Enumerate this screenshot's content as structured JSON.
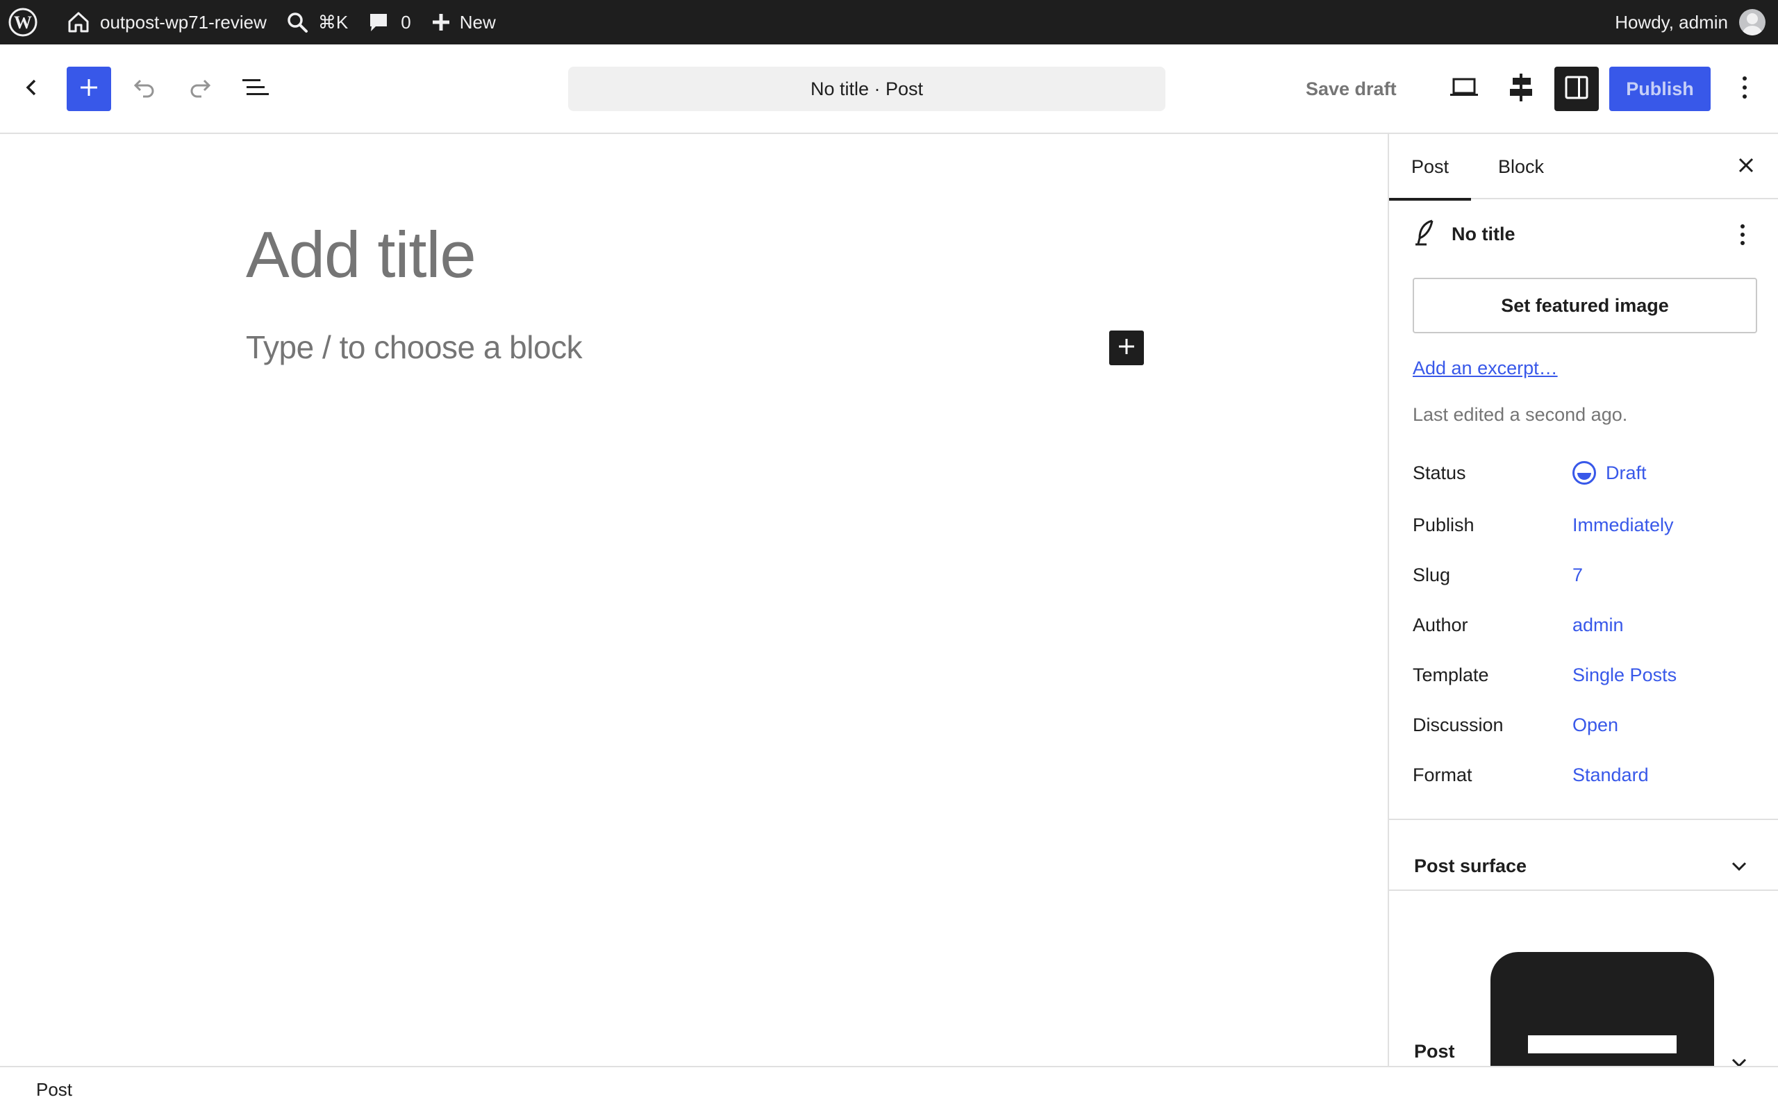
{
  "adminbar": {
    "site_name": "outpost-wp71-review",
    "search_shortcut": "⌘K",
    "comments_count": "0",
    "new_label": "New",
    "greeting": "Howdy, admin"
  },
  "header": {
    "doc_title": "No title · Post",
    "save_draft": "Save draft",
    "publish": "Publish"
  },
  "canvas": {
    "title_placeholder": "Add title",
    "block_placeholder": "Type / to choose a block"
  },
  "sidebar": {
    "tabs": [
      {
        "label": "Post"
      },
      {
        "label": "Block"
      }
    ],
    "summary_title": "No title",
    "featured_image_button": "Set featured image",
    "excerpt_link": "Add an excerpt…",
    "last_edited": "Last edited a second ago.",
    "rows": [
      {
        "label": "Status",
        "value": "Draft"
      },
      {
        "label": "Publish",
        "value": "Immediately"
      },
      {
        "label": "Slug",
        "value": "7"
      },
      {
        "label": "Author",
        "value": "admin"
      },
      {
        "label": "Template",
        "value": "Single Posts"
      },
      {
        "label": "Discussion",
        "value": "Open"
      },
      {
        "label": "Format",
        "value": "Standard"
      }
    ],
    "panels": [
      {
        "title": "Post surface"
      },
      {
        "title": "Post"
      }
    ]
  },
  "footer": {
    "breadcrumb": "Post"
  },
  "colors": {
    "accent": "#3858e9",
    "admin_bar": "#1e1e1e"
  },
  "icons": [
    "wordpress-logo-icon",
    "home-icon",
    "search-icon",
    "comment-icon",
    "plus-icon",
    "back-chevron-icon",
    "undo-icon",
    "redo-icon",
    "document-overview-icon",
    "desktop-preview-icon",
    "style-icon",
    "sidebar-icon",
    "more-vertical-icon",
    "close-icon",
    "post-feather-icon",
    "draft-status-icon",
    "chevron-down-icon"
  ]
}
